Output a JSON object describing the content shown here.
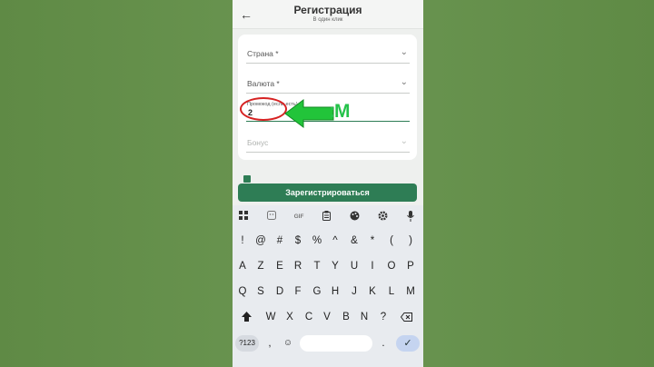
{
  "header": {
    "title": "Регистрация",
    "subtitle": "В один клик",
    "back_icon": "arrow-left-icon"
  },
  "form": {
    "country_label": "Страна *",
    "currency_label": "Валюта *",
    "promo_label": "Промокод (если есть)",
    "promo_value": "2",
    "bonus_label": "Бонус"
  },
  "overlay": {
    "letters": ":M",
    "arrow_color": "#22c43a",
    "circle_color": "#d62222"
  },
  "register_button": "Зарегистрироваться",
  "keyboard": {
    "toolbar": [
      "grid-icon",
      "sticker-icon",
      "GIF",
      "clipboard-icon",
      "palette-icon",
      "gear-icon",
      "mic-icon"
    ],
    "gif_label": "GIF",
    "row1": [
      "!",
      "@",
      "#",
      "$",
      "%",
      "^",
      "&",
      "*",
      "(",
      ")"
    ],
    "row2": [
      "A",
      "Z",
      "E",
      "R",
      "T",
      "Y",
      "U",
      "I",
      "O",
      "P"
    ],
    "row3": [
      "Q",
      "S",
      "D",
      "F",
      "G",
      "H",
      "J",
      "K",
      "L",
      "M"
    ],
    "row4": [
      "W",
      "X",
      "C",
      "V",
      "B",
      "N",
      "?"
    ],
    "num_key": "?123",
    "comma": ",",
    "period": "."
  },
  "colors": {
    "accent": "#2e7d55",
    "background": "#6b9652"
  }
}
